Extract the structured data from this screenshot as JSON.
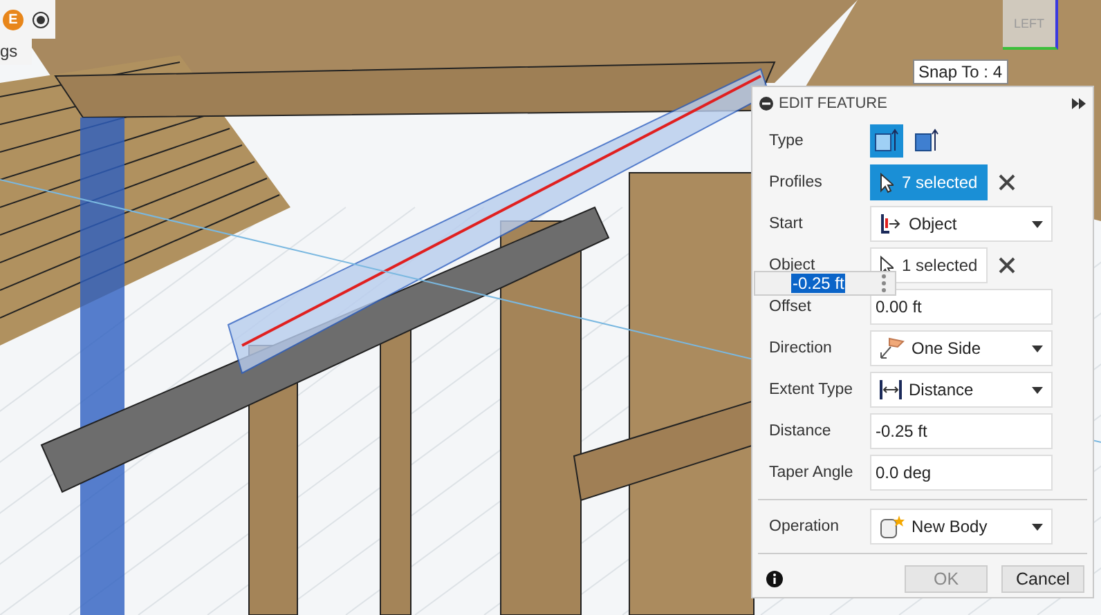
{
  "toolbar": {
    "badge_letter": "E",
    "side_label": "gs"
  },
  "viewport": {
    "view_cube_label": "LEFT",
    "snap_tooltip": "Snap To : 4",
    "inline_input": {
      "value": "-0.25 ft"
    }
  },
  "panel": {
    "title": "EDIT FEATURE",
    "type_options": [
      {
        "selected": true
      },
      {
        "selected": false
      }
    ],
    "type_label": "Type",
    "fields": [
      {
        "kind": "selection",
        "label": "Profiles",
        "value": "7 selected",
        "selected": true
      },
      {
        "kind": "dropdown",
        "label": "Start",
        "value": "Object"
      },
      {
        "kind": "selection",
        "label": "Object",
        "value": "1 selected",
        "selected": false
      },
      {
        "kind": "input",
        "label": "Offset",
        "value": "0.00 ft"
      },
      {
        "kind": "dropdown",
        "label": "Direction",
        "value": "One Side"
      },
      {
        "kind": "dropdown",
        "label": "Extent Type",
        "value": "Distance"
      },
      {
        "kind": "input",
        "label": "Distance",
        "value": "-0.25 ft"
      },
      {
        "kind": "input",
        "label": "Taper Angle",
        "value": "0.0 deg"
      }
    ],
    "operation": {
      "kind": "dropdown",
      "label": "Operation",
      "value": "New Body"
    },
    "buttons": [
      {
        "label": "OK",
        "disabled": true
      },
      {
        "label": "Cancel",
        "disabled": false
      }
    ]
  }
}
